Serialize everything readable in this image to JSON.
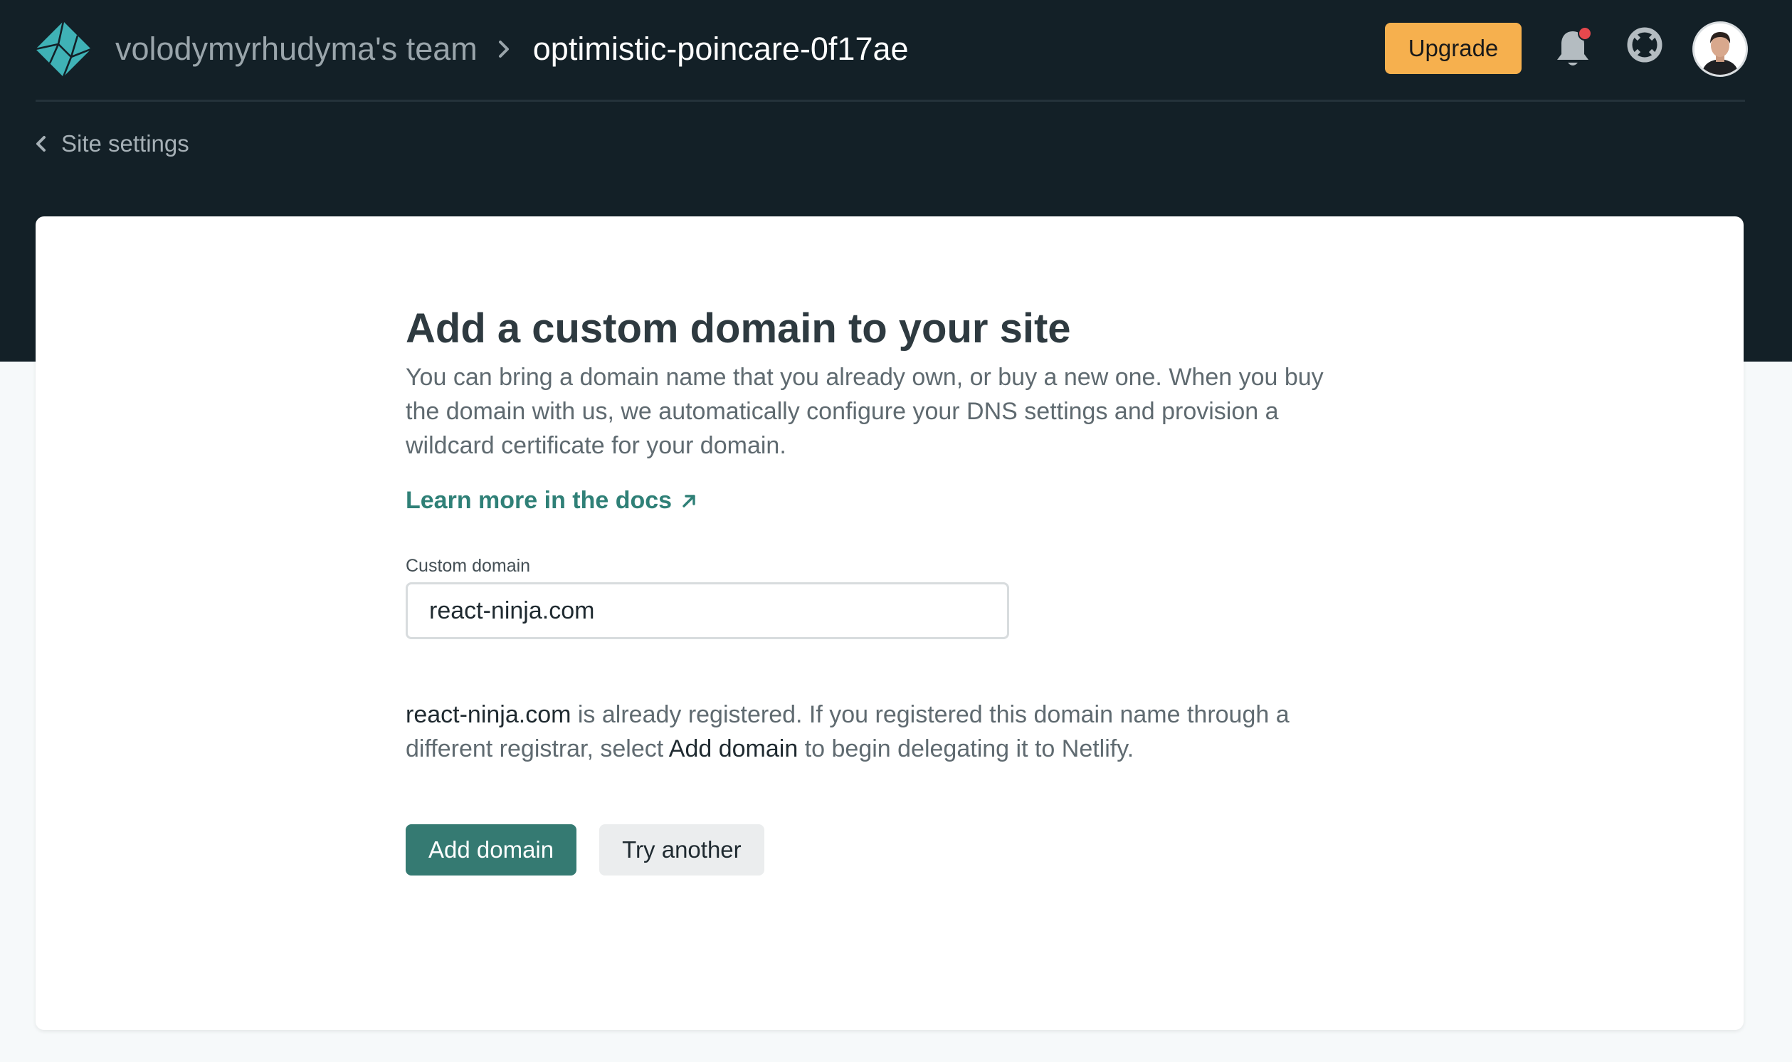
{
  "header": {
    "team_name": "volodymyrhudyma's team",
    "site_name": "optimistic-poincare-0f17ae",
    "upgrade_label": "Upgrade",
    "logo_icon": "netlify-logo-icon",
    "notification_icon": "bell-icon",
    "help_icon": "lifebuoy-icon",
    "avatar": "user-avatar"
  },
  "nav": {
    "back_label": "Site settings"
  },
  "main": {
    "title": "Add a custom domain to your site",
    "description": "You can bring a domain name that you already own, or buy a new one. When you buy the domain with us, we automatically configure your DNS settings and provision a wildcard certificate for your domain.",
    "docs_link": "Learn more in the docs",
    "field_label": "Custom domain",
    "field_value": "react-ninja.com",
    "notice": {
      "domain": "react-ninja.com",
      "text_1": " is already registered. If you registered this domain name through a different registrar, select ",
      "action": "Add domain",
      "text_2": " to begin delegating it to Netlify."
    },
    "primary_button": "Add domain",
    "secondary_button": "Try another"
  },
  "colors": {
    "header_bg": "#132027",
    "accent": "#357a72",
    "link": "#2f8077",
    "upgrade": "#f6b04e",
    "notification_dot": "#e5484d"
  }
}
